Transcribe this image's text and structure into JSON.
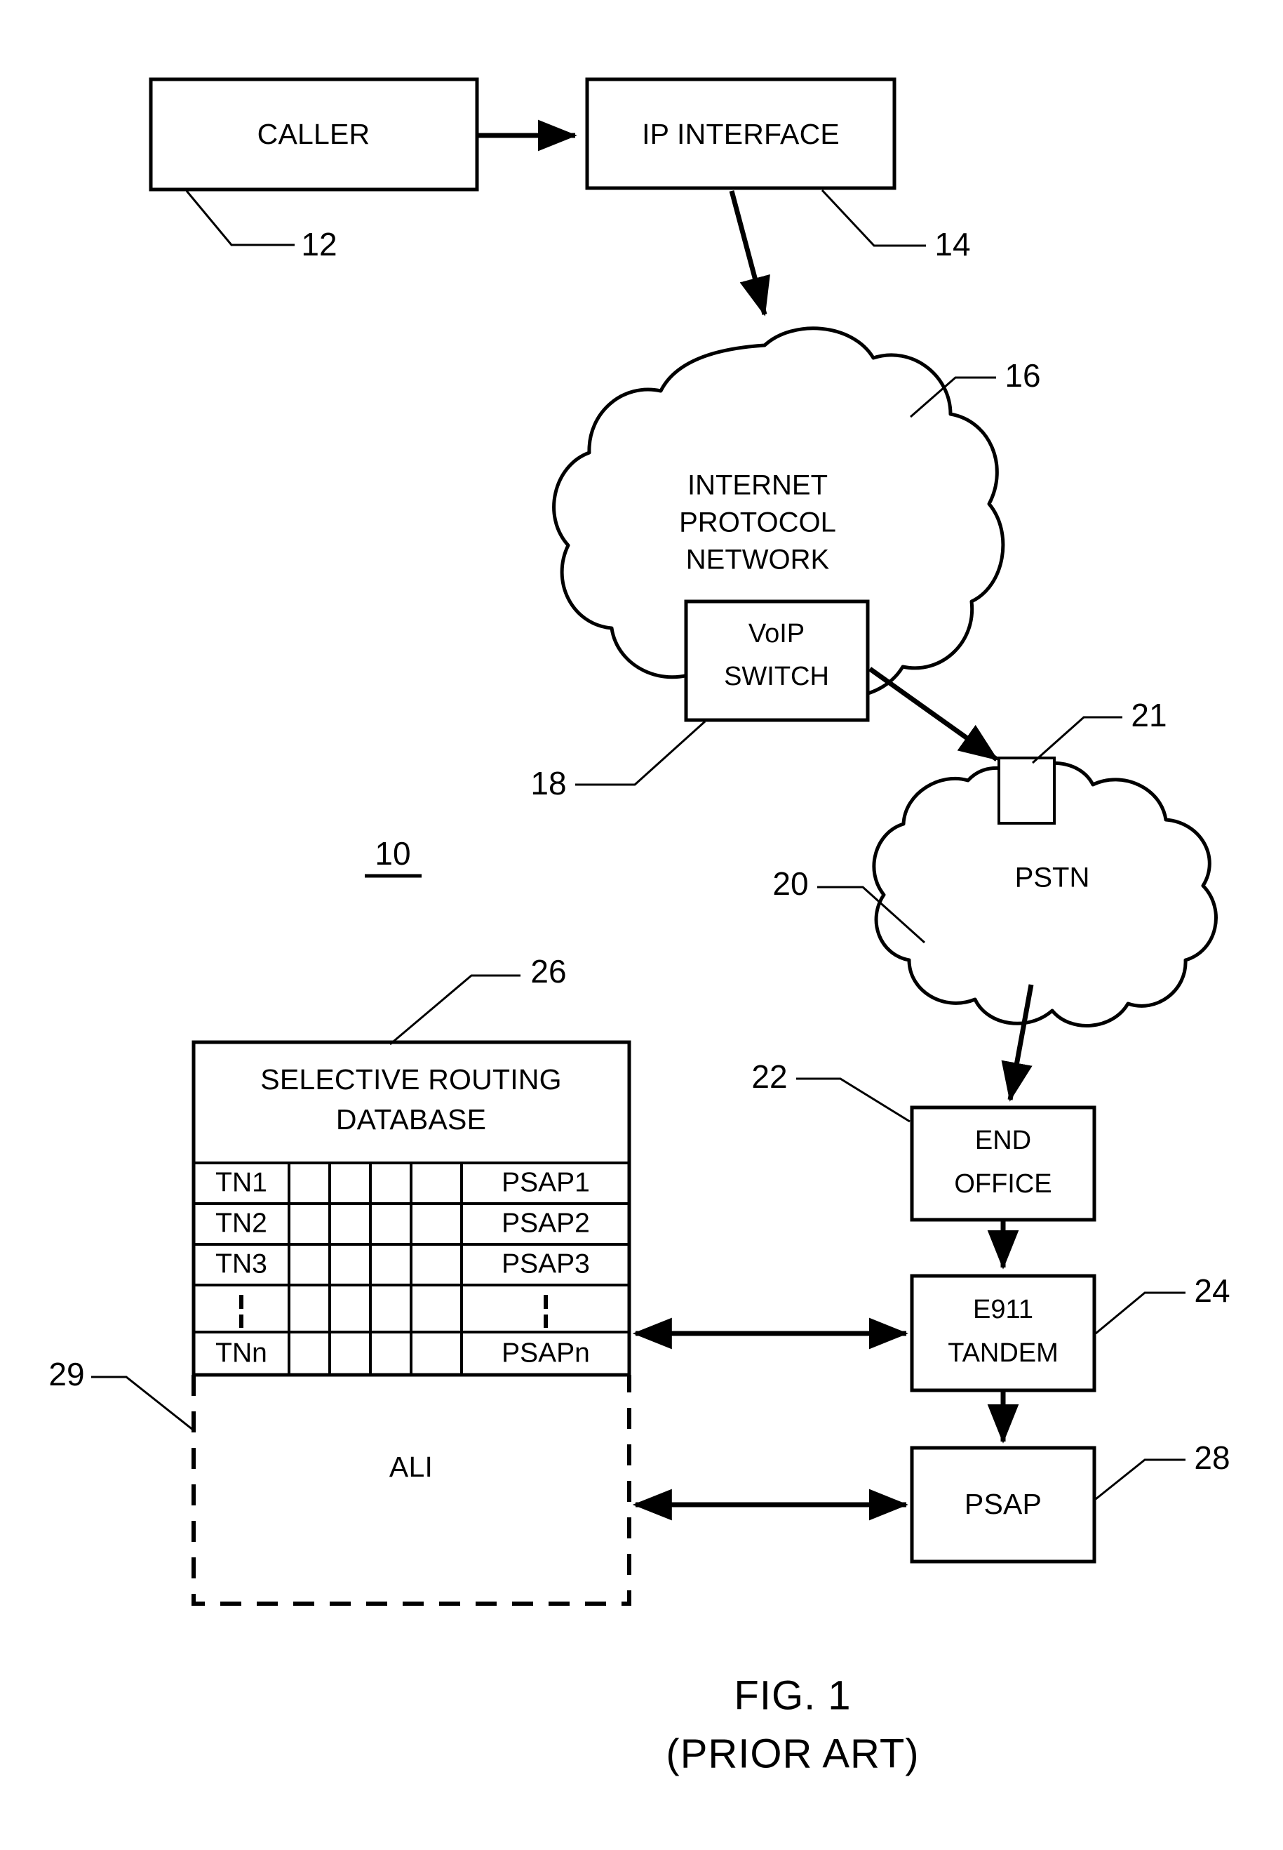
{
  "figure": {
    "caption_line1": "FIG. 1",
    "caption_line2": "(PRIOR ART)",
    "system_ref": "10"
  },
  "nodes": {
    "caller": {
      "label": "CALLER",
      "ref": "12"
    },
    "ip_interface": {
      "label": "IP INTERFACE",
      "ref": "14"
    },
    "ip_network": {
      "label_line1": "INTERNET",
      "label_line2": "PROTOCOL",
      "label_line3": "NETWORK",
      "ref": "16"
    },
    "voip_switch": {
      "label_line1": "VoIP",
      "label_line2": "SWITCH",
      "ref": "18"
    },
    "pstn": {
      "label": "PSTN",
      "ref": "20"
    },
    "gateway": {
      "ref": "21"
    },
    "end_office": {
      "label_line1": "END",
      "label_line2": "OFFICE",
      "ref": "22"
    },
    "e911_tandem": {
      "label_line1": "E911",
      "label_line2": "TANDEM",
      "ref": "24"
    },
    "psap": {
      "label": "PSAP",
      "ref": "28"
    },
    "selective_routing_database": {
      "title_line1": "SELECTIVE ROUTING",
      "title_line2": "DATABASE",
      "ref": "26"
    },
    "ali": {
      "label": "ALI",
      "ref": "29"
    }
  },
  "routing_table": {
    "column_count": 6,
    "rows": [
      {
        "tn": "TN1",
        "psap": "PSAP1"
      },
      {
        "tn": "TN2",
        "psap": "PSAP2"
      },
      {
        "tn": "TN3",
        "psap": "PSAP3"
      },
      {
        "tn": "",
        "psap": ""
      },
      {
        "tn": "TNn",
        "psap": "PSAPn"
      }
    ]
  },
  "colors": {
    "ink": "#000000",
    "paper": "#ffffff"
  }
}
